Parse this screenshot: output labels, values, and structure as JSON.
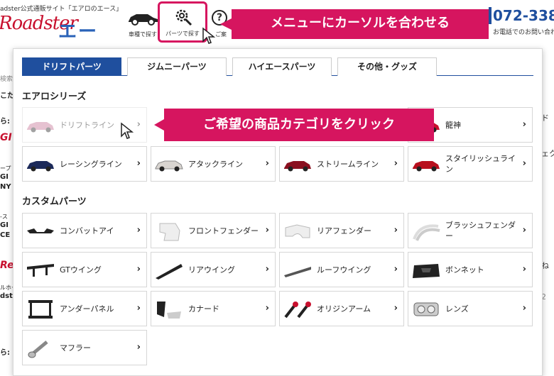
{
  "header": {
    "tagline": "adster公式通販サイト「エアロのエース」",
    "logo_script": "Roadster",
    "logo_ace": "エース",
    "car_search_label": "車種で探す",
    "parts_search_label": "パーツで探す",
    "help_label": "ご案",
    "help_glyph": "?",
    "phone": "072-338",
    "phone_note": "お電話でのお問い合わせ"
  },
  "sidebar_fragments": [
    "検索",
    "こた",
    "ら:",
    "GI",
    "ープ",
    "GI",
    "NY",
    "-ス",
    "GI",
    "CE",
    "Re",
    "ルホー",
    "dst",
    "ら:"
  ],
  "right_fragments": [
    "ド",
    "ェク",
    "ね",
    "2"
  ],
  "callouts": {
    "top": "メニューにカーソルを合わせる",
    "mid": "ご希望の商品カテゴリをクリック"
  },
  "tabs": [
    {
      "label": "ドリフトパーツ",
      "active": true
    },
    {
      "label": "ジムニーパーツ",
      "active": false
    },
    {
      "label": "ハイエースパーツ",
      "active": false
    },
    {
      "label": "その他・グッズ",
      "active": false
    }
  ],
  "aero_section": {
    "title": "エアロシリーズ",
    "items": [
      {
        "label": "ドリフトライン",
        "icon": "drift-car-icon"
      },
      {
        "label": "",
        "icon": "hidden"
      },
      {
        "label": "",
        "icon": "hidden"
      },
      {
        "label": "龍神",
        "icon": "ryujin-car-icon"
      },
      {
        "label": "レーシングライン",
        "icon": "racing-car-icon"
      },
      {
        "label": "アタックライン",
        "icon": "attack-car-icon"
      },
      {
        "label": "ストリームライン",
        "icon": "stream-car-icon"
      },
      {
        "label": "スタイリッシュライン",
        "icon": "stylish-car-icon"
      }
    ]
  },
  "custom_section": {
    "title": "カスタムパーツ",
    "items": [
      {
        "label": "コンバットアイ",
        "icon": "combat-eye-icon"
      },
      {
        "label": "フロントフェンダー",
        "icon": "front-fender-icon"
      },
      {
        "label": "リアフェンダー",
        "icon": "rear-fender-icon"
      },
      {
        "label": "ブラッシュフェンダー",
        "icon": "brush-fender-icon"
      },
      {
        "label": "GTウイング",
        "icon": "gt-wing-icon"
      },
      {
        "label": "リアウイング",
        "icon": "rear-wing-icon"
      },
      {
        "label": "ルーフウイング",
        "icon": "roof-wing-icon"
      },
      {
        "label": "ボンネット",
        "icon": "bonnet-icon"
      },
      {
        "label": "アンダーパネル",
        "icon": "under-panel-icon"
      },
      {
        "label": "カナード",
        "icon": "canard-icon"
      },
      {
        "label": "オリジンアーム",
        "icon": "origin-arm-icon"
      },
      {
        "label": "レンズ",
        "icon": "lens-icon"
      },
      {
        "label": "マフラー",
        "icon": "muffler-icon"
      }
    ]
  },
  "chevron": "›",
  "colors": {
    "accent": "#d6155f",
    "tab_active": "#1f4f9e",
    "brand_red": "#c8102e",
    "brand_blue": "#2a63b8"
  }
}
